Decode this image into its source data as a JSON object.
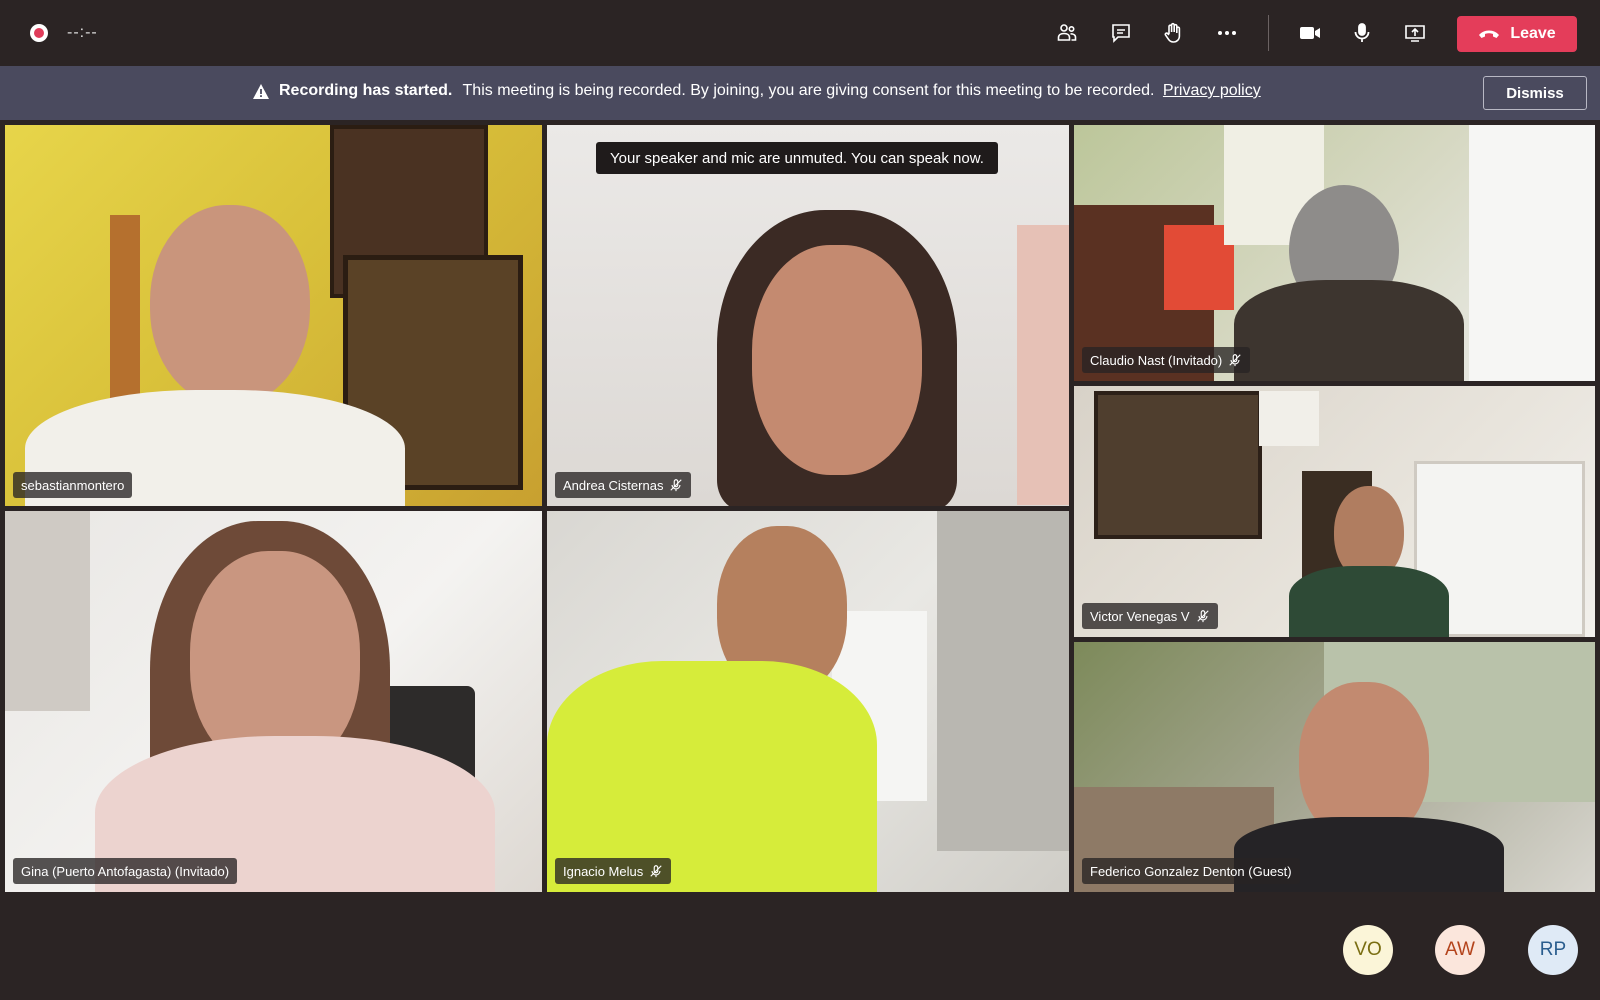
{
  "topbar": {
    "timer": "--:--",
    "leave_label": "Leave"
  },
  "banner": {
    "title": "Recording has started.",
    "message": "This meeting is being recorded. By joining, you are giving consent for this meeting to be recorded.",
    "link": "Privacy policy",
    "dismiss_label": "Dismiss"
  },
  "toast": "Your speaker and mic are unmuted. You can speak now.",
  "participants": [
    {
      "name": "sebastianmontero",
      "muted": false
    },
    {
      "name": "Andrea Cisternas",
      "muted": true
    },
    {
      "name": "Claudio Nast (Invitado)",
      "muted": true
    },
    {
      "name": "Victor Venegas V",
      "muted": true
    },
    {
      "name": "Gina (Puerto Antofagasta) (Invitado)",
      "muted": false
    },
    {
      "name": "Ignacio Melus",
      "muted": true
    },
    {
      "name": "Federico Gonzalez Denton (Guest)",
      "muted": false
    }
  ],
  "avatars": [
    {
      "initials": "VO",
      "bg": "#fbf5d8",
      "fg": "#7a6e12"
    },
    {
      "initials": "AW",
      "bg": "#fbe6dc",
      "fg": "#b4441c"
    },
    {
      "initials": "RP",
      "bg": "#dfeaf6",
      "fg": "#2a5d8e"
    }
  ],
  "colors": {
    "leave": "#e43d5a",
    "banner": "#4a4a5e",
    "background": "#2b2424"
  }
}
